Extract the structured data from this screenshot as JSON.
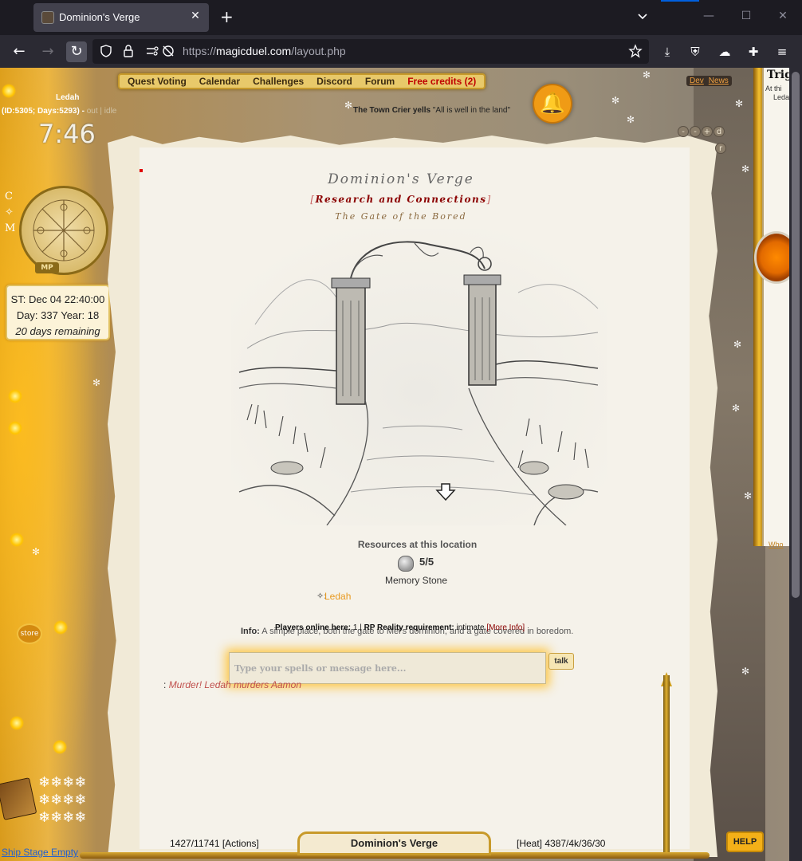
{
  "browser": {
    "tab_title": "Dominion's Verge",
    "url_scheme": "https://",
    "url_host": "magicduel.com",
    "url_path": "/layout.php"
  },
  "menu": {
    "items": [
      "Quest Voting",
      "Calendar",
      "Challenges",
      "Discord",
      "Forum"
    ],
    "free_credits": "Free credits (2)",
    "dev": "Dev",
    "news": "News"
  },
  "crier": {
    "who": "The Town Crier yells",
    "message": "\"All is well in the land\""
  },
  "character": {
    "name": "Ledah",
    "id_line": "(ID:5305; Days:5293) -",
    "out": "out",
    "sep": "|",
    "idle": "idle",
    "clock": "7:46",
    "cm_letters": [
      "C",
      "✧",
      "M"
    ],
    "mp_label": "MP"
  },
  "time_box": {
    "st": "ST: Dec 04 22:40:00",
    "day_year": "Day: 337 Year: 18",
    "remaining": "20 days remaining"
  },
  "location": {
    "title": "Dominion's Verge",
    "subtitle": "Research and Connections",
    "bracket_open": "[",
    "bracket_close": "]",
    "subtitle2": "The Gate of the Bored"
  },
  "resources": {
    "heading": "Resources at this location",
    "count": "5/5",
    "name": "Memory Stone"
  },
  "players": {
    "mark": "✧:",
    "name": "Ledah",
    "online_label": "Players online here:",
    "online_count": "1",
    "sep": "|",
    "rp_label": "RP Reality requirement:",
    "rp_value": "intimate",
    "more_info": "[More Info]"
  },
  "info": {
    "label": "Info:",
    "text": "A simple place, both the gate to Mel's dominion, and a gate covered in boredom."
  },
  "chat": {
    "placeholder": "Type your spells or message here...",
    "talk": "talk",
    "msg_prefix": ":",
    "msg_text": "Murder! Ledah murders Aamon"
  },
  "right_panel": {
    "title": "Trig",
    "line1": "At thi",
    "line2": "Leda",
    "link": "Who"
  },
  "mini_buttons": [
    "-",
    "-",
    "+",
    "d",
    "r"
  ],
  "store": "store",
  "footer_links": "Ship Stage Empty",
  "bottom": {
    "actions": "1427/11741 [Actions]",
    "location_tab": "Dominion's Verge",
    "heat": "[Heat] 4387/4k/36/30",
    "help": "HELP"
  }
}
